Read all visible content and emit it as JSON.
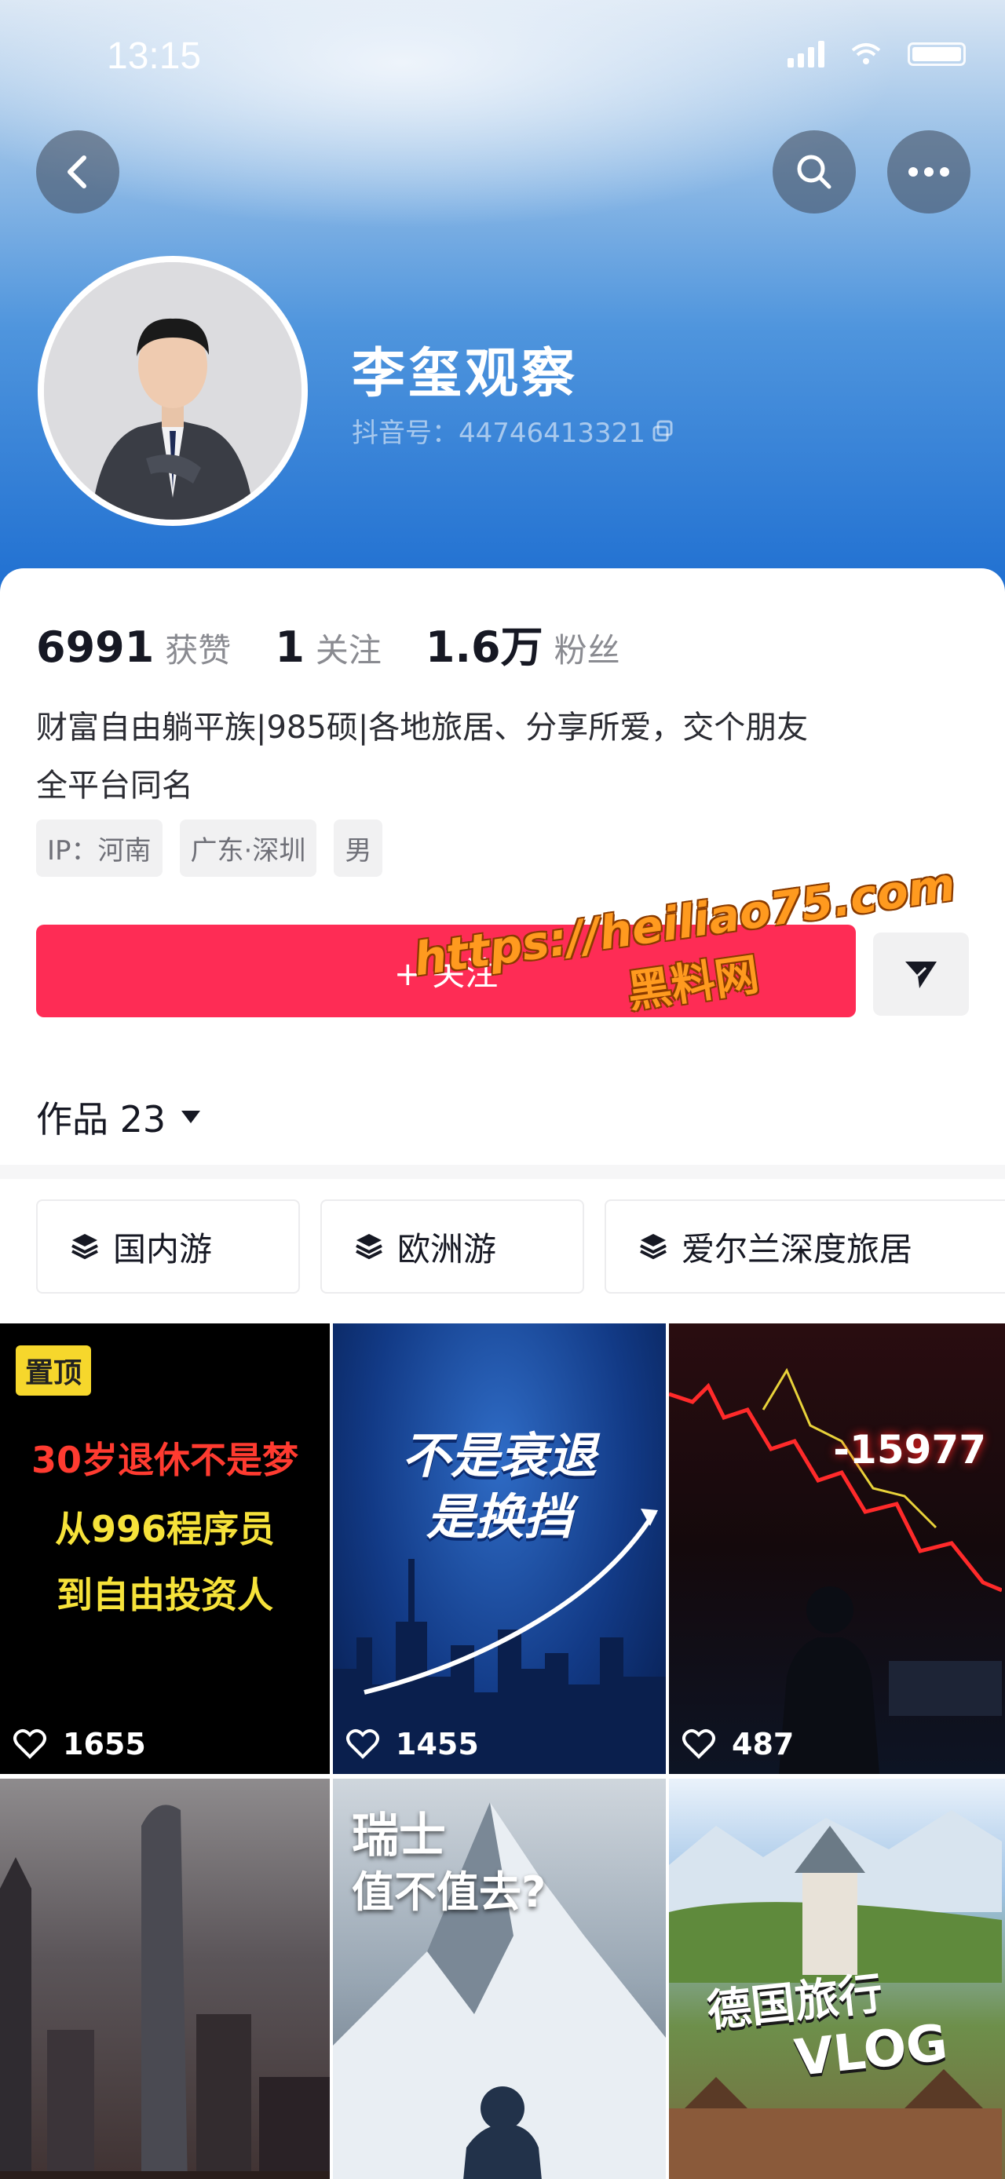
{
  "status_bar": {
    "time": "13:15"
  },
  "profile": {
    "nickname": "李玺观察",
    "douyin_id": "抖音号：44746413321"
  },
  "stats": [
    {
      "value": "6991",
      "label": "获赞"
    },
    {
      "value": "1",
      "label": "关注"
    },
    {
      "value": "1.6万",
      "label": "粉丝"
    }
  ],
  "bio": {
    "line1": "财富自由躺平族|985硕|各地旅居、分享所爱，交个朋友",
    "line2": "全平台同名"
  },
  "tags": [
    "IP：河南",
    "广东·深圳",
    "男"
  ],
  "actions": {
    "follow_label": "+ 关注"
  },
  "works_tab": {
    "label": "作品 23"
  },
  "collections": [
    "国内游",
    "欧洲游",
    "爱尔兰深度旅居"
  ],
  "videos": [
    {
      "pinned_label": "置顶",
      "lines": [
        "30岁退休不是梦",
        "从996程序员",
        "到自由投资人"
      ],
      "likes": "1655"
    },
    {
      "lines": [
        "不是衰退",
        "是换挡"
      ],
      "likes": "1455"
    },
    {
      "overlay": "-15977",
      "likes": "487"
    },
    {
      "likes": ""
    },
    {
      "lines": [
        "瑞士",
        "值不值去?"
      ],
      "likes": ""
    },
    {
      "lines": [
        "德国旅行",
        "VLOG"
      ],
      "likes": ""
    }
  ],
  "watermark": {
    "url": "https://heiliao75.com",
    "name": "黑料网"
  },
  "colors": {
    "follow": "#fe2c55",
    "header_gradient_end": "#1f6fd1",
    "pin_badge": "#f6d72c"
  }
}
